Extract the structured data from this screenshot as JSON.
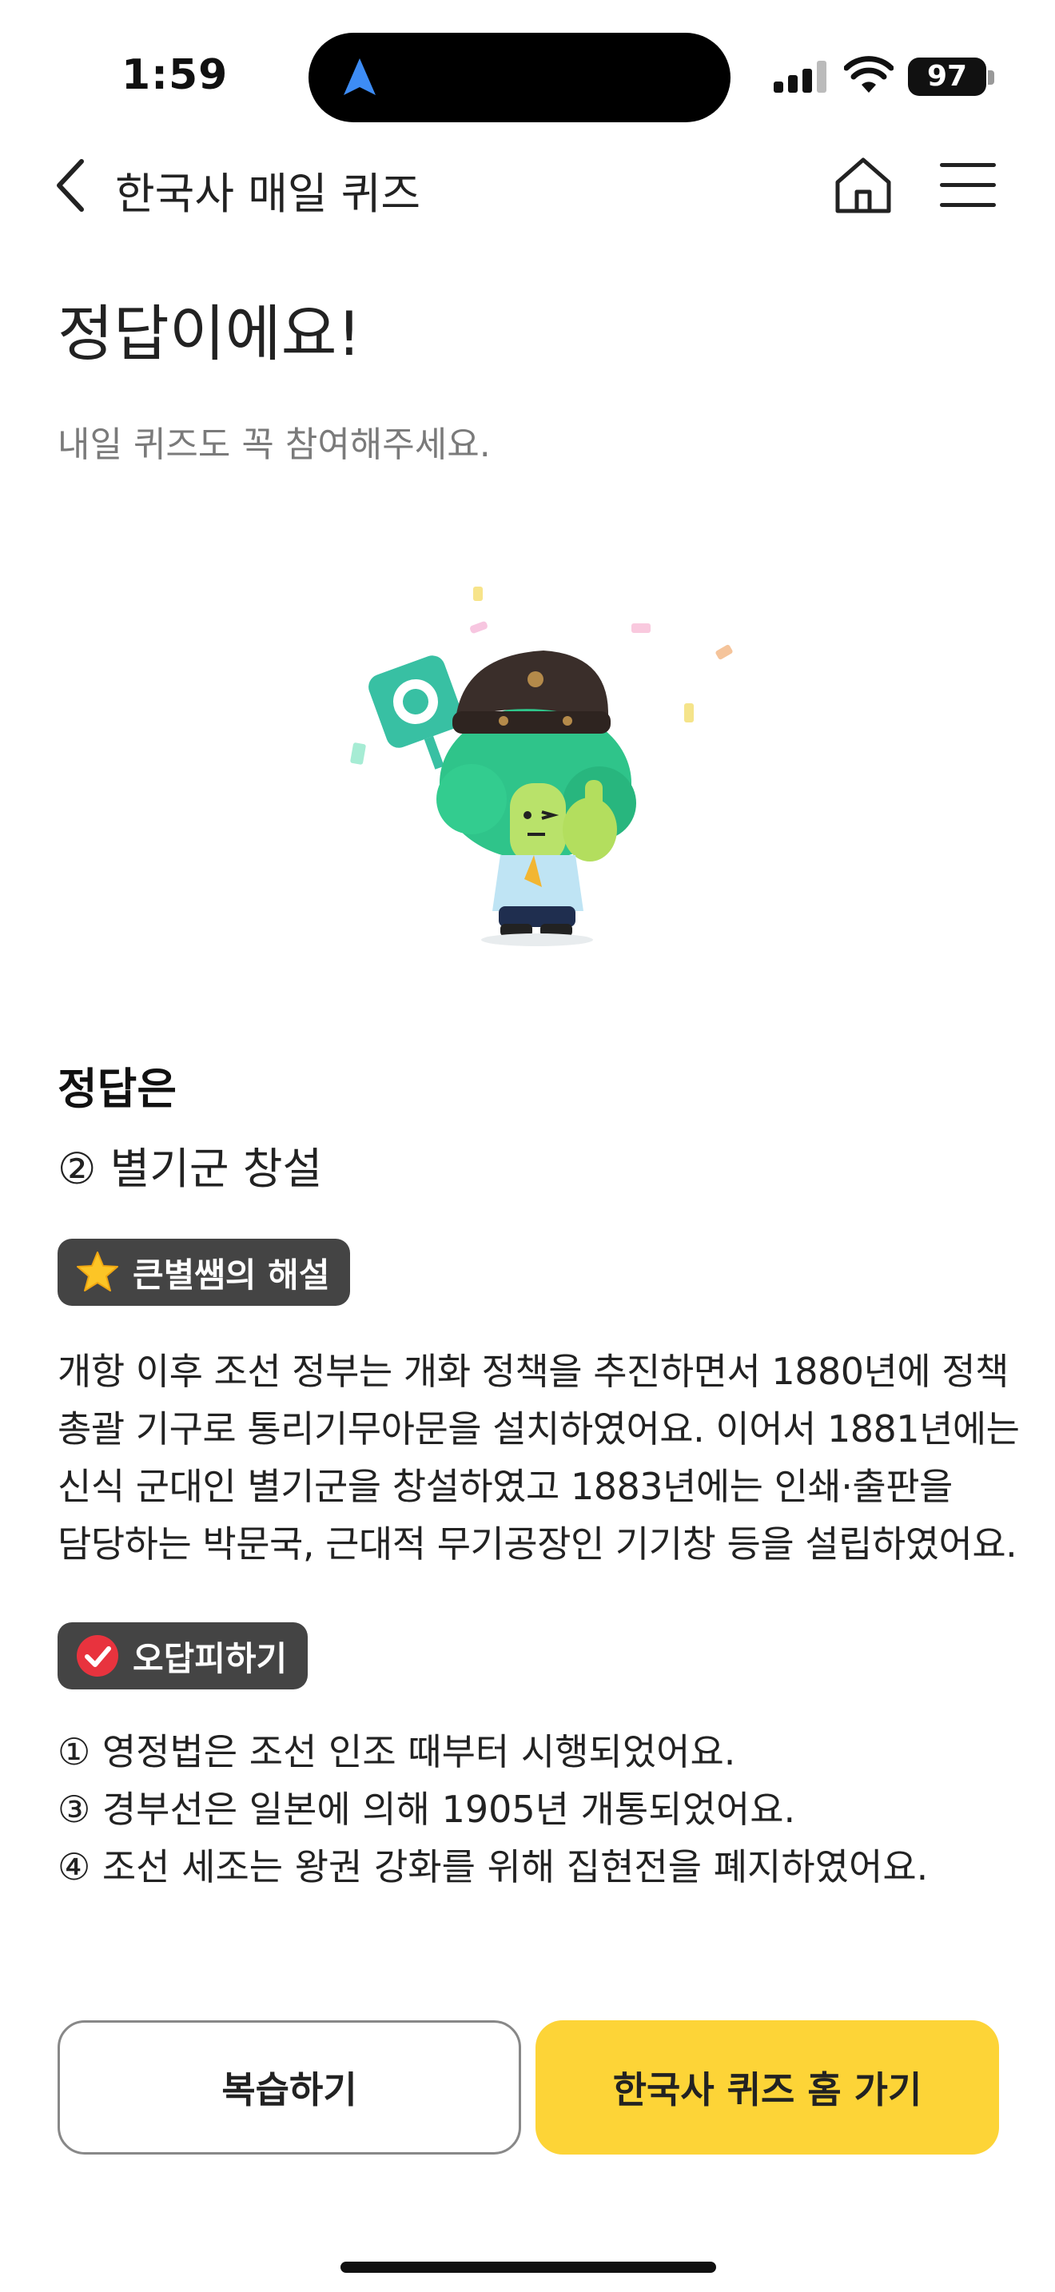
{
  "status_bar": {
    "time": "1:59",
    "battery": "97",
    "icons": [
      "navigation-arrow-icon",
      "signal-icon",
      "wifi-icon",
      "battery-icon"
    ]
  },
  "header": {
    "back_icon": "chevron-left-icon",
    "title": "한국사 매일 퀴즈",
    "home_icon": "home-icon",
    "menu_icon": "hamburger-menu-icon"
  },
  "result": {
    "title": "정답이에요!",
    "subtitle": "내일 퀴즈도 꼭 참여해주세요."
  },
  "illustration": {
    "name": "character-thumbs-up-with-o-sign",
    "accent_color": "#2fc48a"
  },
  "answer": {
    "heading": "정답은",
    "text": "② 별기군 창설"
  },
  "explanation": {
    "badge_icon": "star-icon",
    "badge_label": "큰별쌤의 해설",
    "lines": [
      "개항 이후 조선 정부는 개화 정책을 추진하면서 1880년에 정책",
      "총괄 기구로 통리기무아문을 설치하였어요. 이어서 1881년에는",
      "신식 군대인 별기군을 창설하였고 1883년에는 인쇄·출판을",
      "담당하는 박문국, 근대적 무기공장인 기기창 등을 설립하였어요."
    ]
  },
  "wrong_answers": {
    "badge_icon": "red-check-icon",
    "badge_label": "오답피하기",
    "items": [
      "① 영정법은 조선 인조 때부터 시행되었어요.",
      "③ 경부선은 일본에 의해 1905년 개통되었어요.",
      "④ 조선 세조는 왕권 강화를 위해 집현전을 폐지하였어요."
    ]
  },
  "buttons": {
    "review_label": "복습하기",
    "home_label": "한국사 퀴즈 홈 가기",
    "home_color": "#fdd437"
  }
}
